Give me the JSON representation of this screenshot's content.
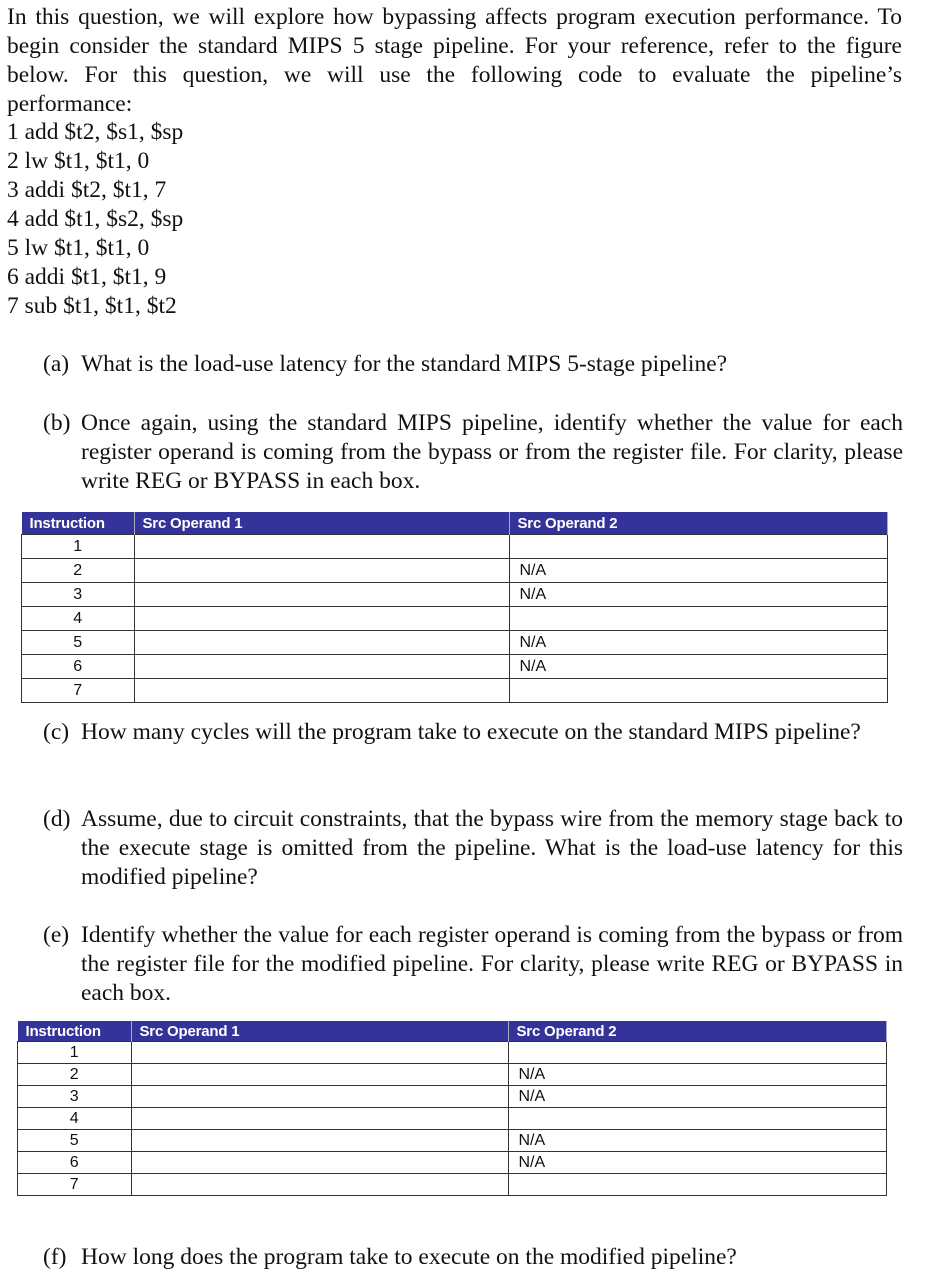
{
  "intro": "In this question, we will explore how bypassing affects program execution performance. To begin consider the standard MIPS 5 stage pipeline. For your reference, refer to the figure below. For this question, we will use the following code to evaluate the pipeline’s performance:",
  "code": [
    "1 add $t2, $s1, $sp",
    "2 lw $t1, $t1, 0",
    "3 addi $t2, $t1, 7",
    "4 add $t1, $s2, $sp",
    "5 lw $t1, $t1, 0",
    "6 addi $t1, $t1, 9",
    "7 sub $t1, $t1, $t2"
  ],
  "questions": {
    "a": {
      "label": "(a)",
      "text": "What is the load-use latency for the standard MIPS 5-stage pipeline?"
    },
    "b": {
      "label": "(b)",
      "text": "Once again, using the standard MIPS pipeline, identify whether the value for each register operand is coming from the bypass or from the register file. For clarity, please write REG or BYPASS in each box."
    },
    "c": {
      "label": "(c)",
      "text": "How many cycles will the program take to execute on the standard MIPS pipeline?"
    },
    "d": {
      "label": "(d)",
      "text": "Assume, due to circuit constraints, that the bypass wire from the memory stage back to the execute stage is omitted from the pipeline. What is the load-use latency for this modified pipeline?"
    },
    "e": {
      "label": "(e)",
      "text": "Identify whether the value for each register operand is coming from the bypass or from the register file for the modified pipeline. For clarity, please write REG or BYPASS in each box."
    },
    "f": {
      "label": "(f)",
      "text": "How long does the program take to execute on the modified pipeline?"
    }
  },
  "tables": {
    "headers": [
      "Instruction",
      "Src Operand 1",
      "Src Operand 2"
    ],
    "header_color": "#33339a",
    "rows": [
      [
        "1",
        "",
        ""
      ],
      [
        "2",
        "",
        "N/A"
      ],
      [
        "3",
        "",
        "N/A"
      ],
      [
        "4",
        "",
        ""
      ],
      [
        "5",
        "",
        "N/A"
      ],
      [
        "6",
        "",
        "N/A"
      ],
      [
        "7",
        "",
        ""
      ]
    ]
  }
}
